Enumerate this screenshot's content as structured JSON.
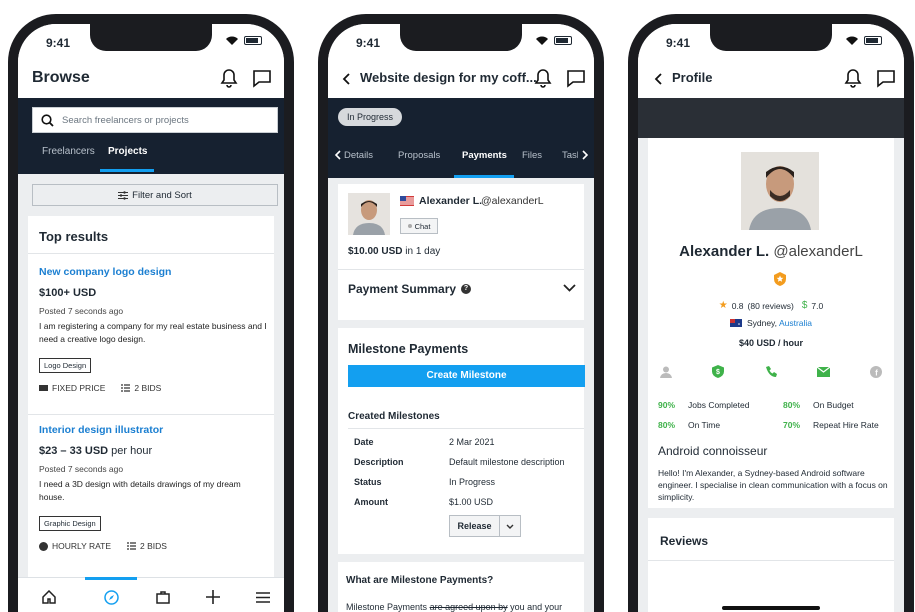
{
  "status": {
    "time": "9:41"
  },
  "phone1": {
    "title": "Browse",
    "search_placeholder": "Search freelancers or projects",
    "tabs": [
      {
        "label": "Freelancers"
      },
      {
        "label": "Projects"
      }
    ],
    "filter_label": "Filter and Sort",
    "section_title": "Top results",
    "projects": [
      {
        "title": "New company logo design",
        "price": "$100+ USD",
        "posted": "Posted 7 seconds ago",
        "desc": "I am registering a company for my real estate business and I need a creative logo design.",
        "tag": "Logo Design",
        "type": "FIXED PRICE",
        "bids": "2 BIDS"
      },
      {
        "title": "Interior design illustrator",
        "price": "$23 – 33 USD",
        "price_suffix": "per hour",
        "posted": "Posted 7 seconds ago",
        "desc": "I need a 3D design with details drawings of my dream house.",
        "tag": "Graphic Design",
        "type": "HOURLY RATE",
        "bids": "2 BIDS"
      }
    ],
    "bottom_nav": [
      "home-icon",
      "compass-icon",
      "briefcase-icon",
      "plus-icon",
      "menu-icon"
    ]
  },
  "phone2": {
    "title": "Website design for my coff...",
    "status_pill": "In Progress",
    "tabs": [
      {
        "label": "Details"
      },
      {
        "label": "Proposals"
      },
      {
        "label": "Payments"
      },
      {
        "label": "Files"
      },
      {
        "label": "Task"
      }
    ],
    "freelancer_name": "Alexander L.",
    "freelancer_handle": "@alexanderL",
    "chat_label": "Chat",
    "bid_amount": "$10.00 USD",
    "bid_suffix": "in 1 day",
    "payment_summary": "Payment Summary",
    "milestone_heading": "Milestone Payments",
    "create_milestone": "Create Milestone",
    "created_heading": "Created Milestones",
    "milestone_rows": [
      {
        "label": "Date",
        "value": "2 Mar 2021"
      },
      {
        "label": "Description",
        "value": "Default milestone description"
      },
      {
        "label": "Status",
        "value": "In Progress"
      },
      {
        "label": "Amount",
        "value": "$1.00 USD"
      }
    ],
    "release_label": "Release",
    "faq_title": "What are Milestone Payments?",
    "faq_text_a": "Milestone Payments",
    "faq_text_b": "are agreed upon by",
    "faq_text_c": "you and your"
  },
  "phone3": {
    "title": "Profile",
    "name": "Alexander L.",
    "handle": "@alexanderL",
    "rating": "0.8",
    "reviews": "(80 reviews)",
    "earnings": "7.0",
    "city": "Sydney,",
    "country": "Australia",
    "rate": "$40 USD / hour",
    "stats": [
      {
        "pct": "90%",
        "label": "Jobs Completed"
      },
      {
        "pct": "80%",
        "label": "On Budget"
      },
      {
        "pct": "80%",
        "label": "On Time"
      },
      {
        "pct": "70%",
        "label": "Repeat Hire Rate"
      }
    ],
    "tagline": "Android connoisseur",
    "bio": "Hello! I'm Alexander, a Sydney-based Android software engineer. I specialise in clean communication with a focus on simplicity.",
    "reviews_heading": "Reviews"
  },
  "colors": {
    "dark_header": "#162130",
    "accent_blue": "#139ff0",
    "link_blue": "#1b7fd1",
    "green": "#3fb24a"
  }
}
